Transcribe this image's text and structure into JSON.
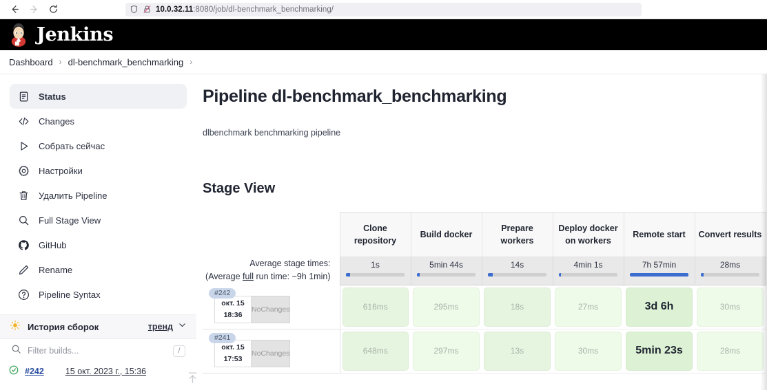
{
  "browser": {
    "back_icon": "arrow-left-icon",
    "forward_icon": "arrow-right-icon",
    "reload_icon": "reload-icon",
    "shield_icon": "shield-icon",
    "insecure_icon": "lock-crossed-icon",
    "url_host": "10.0.32.11",
    "url_rest": ":8080/job/dl-benchmark_benchmarking/"
  },
  "header": {
    "title": "Jenkins",
    "logo": "jenkins-butler-logo"
  },
  "breadcrumb": {
    "items": [
      "Dashboard",
      "dl-benchmark_benchmarking"
    ],
    "separator": "›"
  },
  "sidebar": {
    "items": [
      {
        "label": "Status",
        "icon": "document-icon",
        "active": true
      },
      {
        "label": "Changes",
        "icon": "code-icon",
        "active": false
      },
      {
        "label": "Собрать сейчас",
        "icon": "play-icon",
        "active": false
      },
      {
        "label": "Настройки",
        "icon": "gear-icon",
        "active": false
      },
      {
        "label": "Удалить Pipeline",
        "icon": "trash-icon",
        "active": false
      },
      {
        "label": "Full Stage View",
        "icon": "search-icon",
        "active": false
      },
      {
        "label": "GitHub",
        "icon": "github-icon",
        "active": false
      },
      {
        "label": "Rename",
        "icon": "pencil-icon",
        "active": false
      },
      {
        "label": "Pipeline Syntax",
        "icon": "question-circle-icon",
        "active": false
      }
    ],
    "build_history": {
      "title": "История сборок",
      "sun_icon": "weather-sun-icon",
      "trend_label": "тренд",
      "chevron_icon": "chevron-down-icon",
      "filter_placeholder": "Filter builds...",
      "filter_value": "",
      "filter_icon": "search-icon",
      "shortcut_key": "/",
      "builds": [
        {
          "status_icon": "check-circle-icon",
          "status_color": "#2e9e4f",
          "number": "#242",
          "date": "15 окт. 2023 г., 15:36"
        }
      ],
      "scroll_up_icon": "arrow-up-icon"
    }
  },
  "main": {
    "page_title": "Pipeline dl-benchmark_benchmarking",
    "description": "dlbenchmark benchmarking pipeline",
    "stage_view_title": "Stage View",
    "average_label_line1": "Average stage times:",
    "average_label_line2_pre": "(Average ",
    "average_label_line2_link": "full",
    "average_label_line2_post": " run time: ~9h 1min)",
    "no_changes_label": "No\nChanges"
  },
  "chart_data": {
    "type": "table",
    "title": "Stage View",
    "stages": [
      "Clone repository",
      "Build docker",
      "Prepare workers",
      "Deploy docker on workers",
      "Remote start",
      "Convert results"
    ],
    "average_stage_times": [
      "1s",
      "5min 44s",
      "14s",
      "4min 1s",
      "7h 57min",
      "28ms"
    ],
    "average_bar_fill_pct": [
      7,
      5,
      9,
      4,
      100,
      5
    ],
    "average_full_run_time": "~9h 1min",
    "rows": [
      {
        "build": "#242",
        "date": "окт. 15",
        "time": "18:36",
        "changes": "No Changes",
        "values": [
          "616ms",
          "295ms",
          "18s",
          "27ms",
          "3d 6h",
          "30ms"
        ],
        "emphasis": [
          false,
          false,
          false,
          false,
          true,
          false
        ],
        "shades": [
          "pale",
          "light",
          "pale",
          "light",
          "strong",
          "light"
        ]
      },
      {
        "build": "#241",
        "date": "окт. 15",
        "time": "17:53",
        "changes": "No Changes",
        "values": [
          "648ms",
          "297ms",
          "13s",
          "30ms",
          "5min 23s",
          "28ms"
        ],
        "emphasis": [
          false,
          false,
          false,
          false,
          true,
          false
        ],
        "shades": [
          "pale",
          "light",
          "pale",
          "light",
          "strong",
          "light"
        ]
      }
    ]
  },
  "colors": {
    "jenkins_black": "#000000",
    "link_blue": "#2d4fa1",
    "success_green": "#2e9e4f",
    "bar_blue": "#3c6ecf",
    "cell_green_pale": "#e6f5e0",
    "cell_green_light": "#eefbe9",
    "cell_green_strong": "#ddf2d5"
  }
}
